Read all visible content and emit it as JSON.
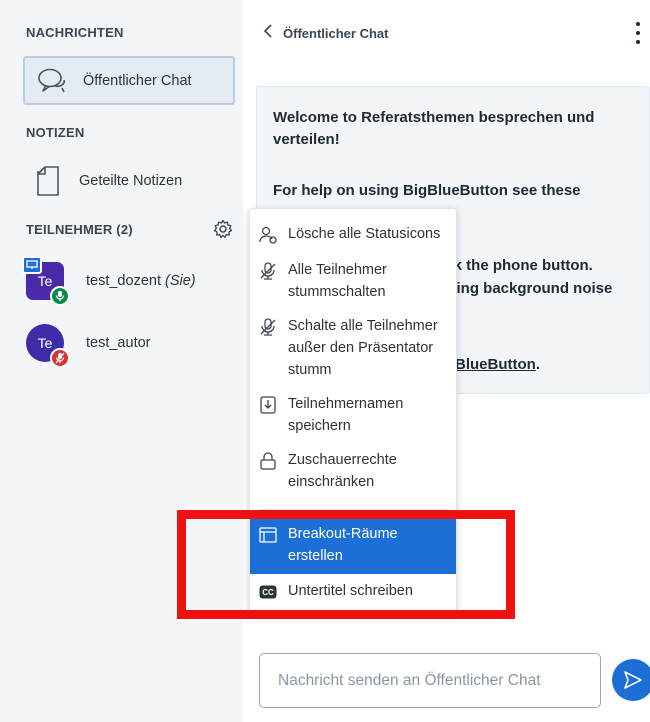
{
  "sidebar": {
    "messages_title": "NACHRICHTEN",
    "public_chat": "Öffentlicher Chat",
    "notes_title": "NOTIZEN",
    "shared_notes": "Geteilte Notizen",
    "participants_title": "TEILNEHMER (2)",
    "users": [
      {
        "initials": "Te",
        "name": "test_dozent",
        "suffix": "(Sie)",
        "role": "moderator",
        "presenter": true,
        "audio": "unmuted"
      },
      {
        "initials": "Te",
        "name": "test_autor",
        "suffix": "",
        "role": "viewer",
        "presenter": false,
        "audio": "muted"
      }
    ]
  },
  "chat": {
    "title": "Öffentlicher Chat",
    "welcome_line1_pre": "Welcome to ",
    "welcome_line1_bold": "Referatsthemen besprechen und",
    "welcome_line2_bold": "verteilen",
    "welcome_line2_post": "!",
    "welcome_help": "For help on using BigBlueButton see these",
    "welcome_partial1": "lick the phone button.",
    "welcome_partial2": "using background noise",
    "welcome_link": "BlueButton",
    "welcome_link_post": ".",
    "input_placeholder": "Nachricht senden an Öffentlicher Chat"
  },
  "menu": {
    "items": [
      {
        "icon": "clear-status-icon",
        "label": "Lösche alle Statusicons"
      },
      {
        "icon": "mute-icon",
        "label": "Alle Teilnehmer stummschalten"
      },
      {
        "icon": "mute-icon",
        "label": "Schalte alle Teilnehmer außer den Präsentator stumm"
      },
      {
        "icon": "download-icon",
        "label": "Teilnehmernamen speichern"
      },
      {
        "icon": "lock-icon",
        "label": "Zuschauerrechte einschränken"
      },
      {
        "icon": "breakout-rooms-icon",
        "label": "Breakout-Räume erstellen",
        "active": true
      },
      {
        "icon": "closed-caption-icon",
        "label": "Untertitel schreiben"
      }
    ]
  },
  "colors": {
    "accent": "#1b6fd6",
    "annotation_red": "#ee1111",
    "sidebar_bg": "#f3f6f9",
    "avatar_purple": "#4a2aa8",
    "muted_red": "#d6342c",
    "unmuted_green": "#0f8a4e"
  }
}
